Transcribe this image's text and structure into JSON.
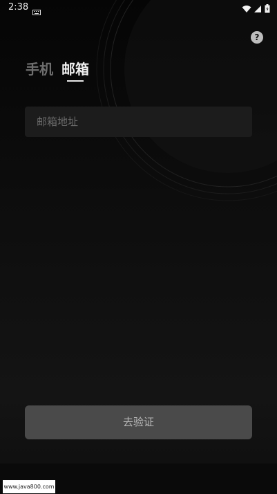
{
  "status_bar": {
    "time": "2:38",
    "icons": [
      "keyboard-icon",
      "wifi-icon",
      "signal-icon",
      "battery-icon"
    ]
  },
  "help": {
    "label": "?"
  },
  "tabs": [
    {
      "label": "手机",
      "selected": false
    },
    {
      "label": "邮箱",
      "selected": true
    }
  ],
  "email_input": {
    "value": "",
    "placeholder": "邮箱地址"
  },
  "verify_button": {
    "label": "去验证"
  },
  "watermark": {
    "text": "www.java800.com"
  },
  "colors": {
    "background": "#0b0b0b",
    "input_background": "#1c1c1c",
    "button_background": "#4a4a4a",
    "active_tab": "#f0f0f0",
    "inactive_tab": "#6e6e6e"
  }
}
